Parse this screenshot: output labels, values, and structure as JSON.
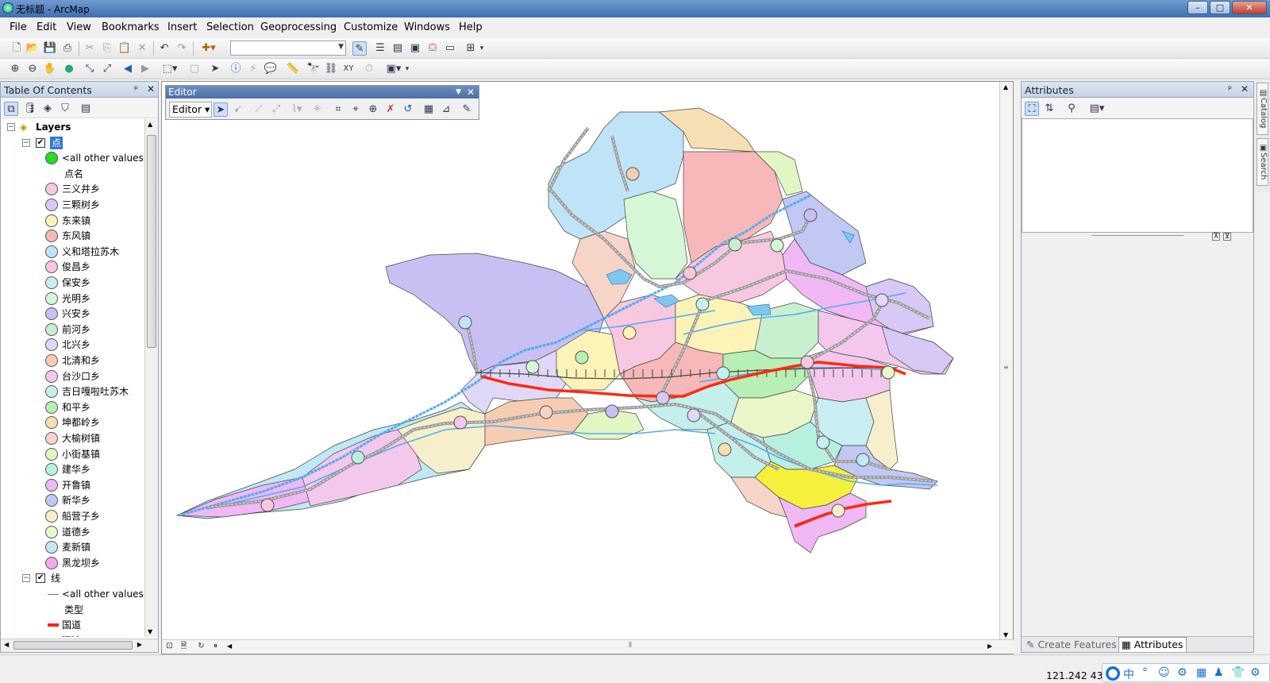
{
  "window": {
    "title": "无标题 - ArcMap",
    "controls": {
      "minimize": "–",
      "maximize": "□",
      "close": "✕"
    }
  },
  "menu": [
    "File",
    "Edit",
    "View",
    "Bookmarks",
    "Insert",
    "Selection",
    "Geoprocessing",
    "Customize",
    "Windows",
    "Help"
  ],
  "toolbar": {
    "scale_value": "",
    "standard_icons": [
      "new-icon",
      "open-icon",
      "save-icon",
      "print-icon",
      "cut-icon",
      "copy-icon",
      "paste-icon",
      "delete-icon",
      "undo-icon",
      "redo-icon",
      "add-data-icon"
    ],
    "tools_icons": [
      "zoom-in-icon",
      "zoom-out-icon",
      "pan-icon",
      "full-extent-icon",
      "fixed-zoom-in-icon",
      "fixed-zoom-out-icon",
      "back-icon",
      "forward-icon",
      "select-features-icon",
      "clear-selection-icon",
      "select-elements-icon",
      "identify-icon",
      "hyperlink-icon",
      "html-popup-icon",
      "measure-icon",
      "find-icon",
      "find-route-icon",
      "go-to-xy-icon",
      "time-slider-icon",
      "create-viewer-icon"
    ]
  },
  "toc": {
    "title": "Table Of Contents",
    "pin": "ᵖ",
    "close": "✕",
    "root": "Layers",
    "point_layer": {
      "name": "点",
      "other_values": "<all other values>",
      "other_color": "#22dd22",
      "field": "点名",
      "items": [
        {
          "label": "三义井乡",
          "color": "#f7c8dc"
        },
        {
          "label": "三颗树乡",
          "color": "#d8c8f5"
        },
        {
          "label": "东来镇",
          "color": "#fbf3b8"
        },
        {
          "label": "东风镇",
          "color": "#f6b8b8"
        },
        {
          "label": "义和塔拉苏木",
          "color": "#bfe3f7"
        },
        {
          "label": "俊昌乡",
          "color": "#f7c8e0"
        },
        {
          "label": "保安乡",
          "color": "#c8eef3"
        },
        {
          "label": "光明乡",
          "color": "#d6f7d6"
        },
        {
          "label": "兴安乡",
          "color": "#c8c0f3"
        },
        {
          "label": "前河乡",
          "color": "#c8f0cf"
        },
        {
          "label": "北兴乡",
          "color": "#e0d8f7"
        },
        {
          "label": "北清和乡",
          "color": "#f6cdb3"
        },
        {
          "label": "台沙口乡",
          "color": "#f4c8ec"
        },
        {
          "label": "吉日嘎啦吐苏木",
          "color": "#c4f0ec"
        },
        {
          "label": "和平乡",
          "color": "#b8efb4"
        },
        {
          "label": "坤都岭乡",
          "color": "#f7dfb4"
        },
        {
          "label": "大榆树镇",
          "color": "#f7d4c8"
        },
        {
          "label": "小街基镇",
          "color": "#e0f7c4"
        },
        {
          "label": "建华乡",
          "color": "#b8f0e0"
        },
        {
          "label": "开鲁镇",
          "color": "#f0b8f5"
        },
        {
          "label": "新华乡",
          "color": "#c0c8f3"
        },
        {
          "label": "船营子乡",
          "color": "#f7efcc"
        },
        {
          "label": "道德乡",
          "color": "#eaf7c8"
        },
        {
          "label": "麦新镇",
          "color": "#c0e8f5"
        },
        {
          "label": "黑龙坝乡",
          "color": "#f2a8ec"
        }
      ]
    },
    "line_layer": {
      "name": "线",
      "other_values": "<all other values>",
      "field": "类型",
      "items": [
        {
          "label": "国道",
          "color": "#ff2200"
        },
        {
          "label": "河流",
          "color": "#5aa8e6"
        }
      ]
    }
  },
  "editor": {
    "title": "Editor",
    "dropdown": "Editor ▾"
  },
  "attributes": {
    "title": "Attributes",
    "tabs": [
      "Create Features",
      "Attributes"
    ]
  },
  "dock": [
    "Catalog",
    "Search"
  ],
  "status": {
    "coords": "121.242  43"
  },
  "ime": [
    "中",
    "°",
    "☺",
    "⚙",
    "▦",
    "♟",
    "👕",
    "⚙"
  ],
  "colors": {
    "road": "#ff2a10",
    "river": "#55aaee",
    "rail": "#777777",
    "highway": "#999999"
  }
}
